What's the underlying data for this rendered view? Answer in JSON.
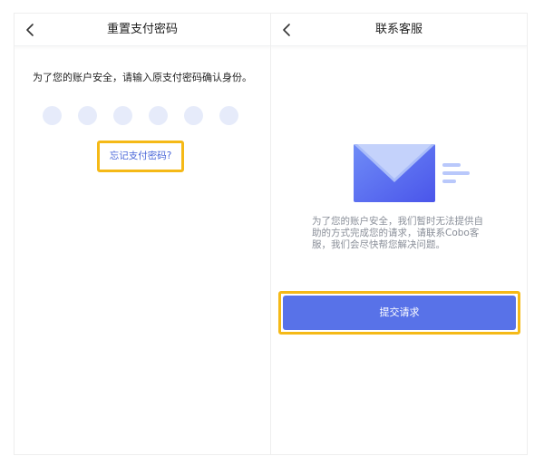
{
  "reset_screen": {
    "title": "重置支付密码",
    "prompt": "为了您的账户安全，请输入原支付密码确认身份。",
    "forgot_link": "忘记支付密码?",
    "pin_length": 6,
    "colors": {
      "dot": "#e6ebfa",
      "link": "#4a67d8",
      "highlight": "#f5b917"
    }
  },
  "support_screen": {
    "title": "联系客服",
    "message": "为了您的账户安全，我们暂时无法提供自助的方式完成您的请求，请联系Cobo客服，我们会尽快帮您解决问题。",
    "submit_label": "提交请求",
    "icons": [
      "envelope-icon",
      "lines-icon"
    ],
    "colors": {
      "button": "#5872e8",
      "envelope": "#5a6df0",
      "text": "#8a8f99"
    }
  }
}
